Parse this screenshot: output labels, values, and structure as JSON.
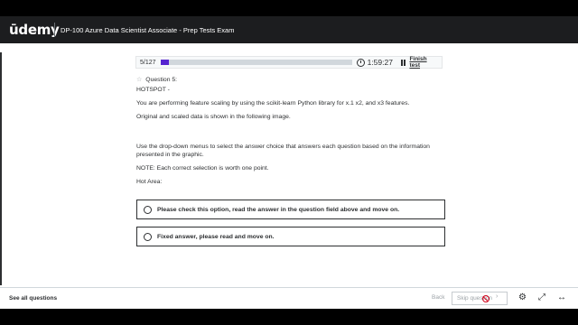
{
  "header": {
    "logo": "ūdemy",
    "course_title": "DP-100 Azure Data Scientist Associate - Prep Tests Exam"
  },
  "progress": {
    "count_label": "5/127",
    "fraction": 0.0394,
    "timer": "1:59:27",
    "finish_label": "Finish test"
  },
  "question": {
    "title": "Question 5:",
    "lines": [
      "HOTSPOT -",
      "You are performing feature scaling by using the scikit-learn Python library for x.1 x2, and x3 features.",
      "Original and scaled data is shown in the following image.",
      "Use the drop-down menus to select the answer choice that answers each question based on the information presented in the graphic.",
      "NOTE: Each correct selection is worth one point.",
      "Hot Area:"
    ]
  },
  "options": [
    "Please check this option, read the answer in the question field above and move on.",
    "Fixed answer, please read and move on."
  ],
  "footer": {
    "see_all": "See all questions",
    "back": "Back",
    "skip": "Skip question",
    "skip_chevron": "›",
    "icons": [
      "gear-icon",
      "expand-icon",
      "horizontal-expand-icon"
    ]
  }
}
